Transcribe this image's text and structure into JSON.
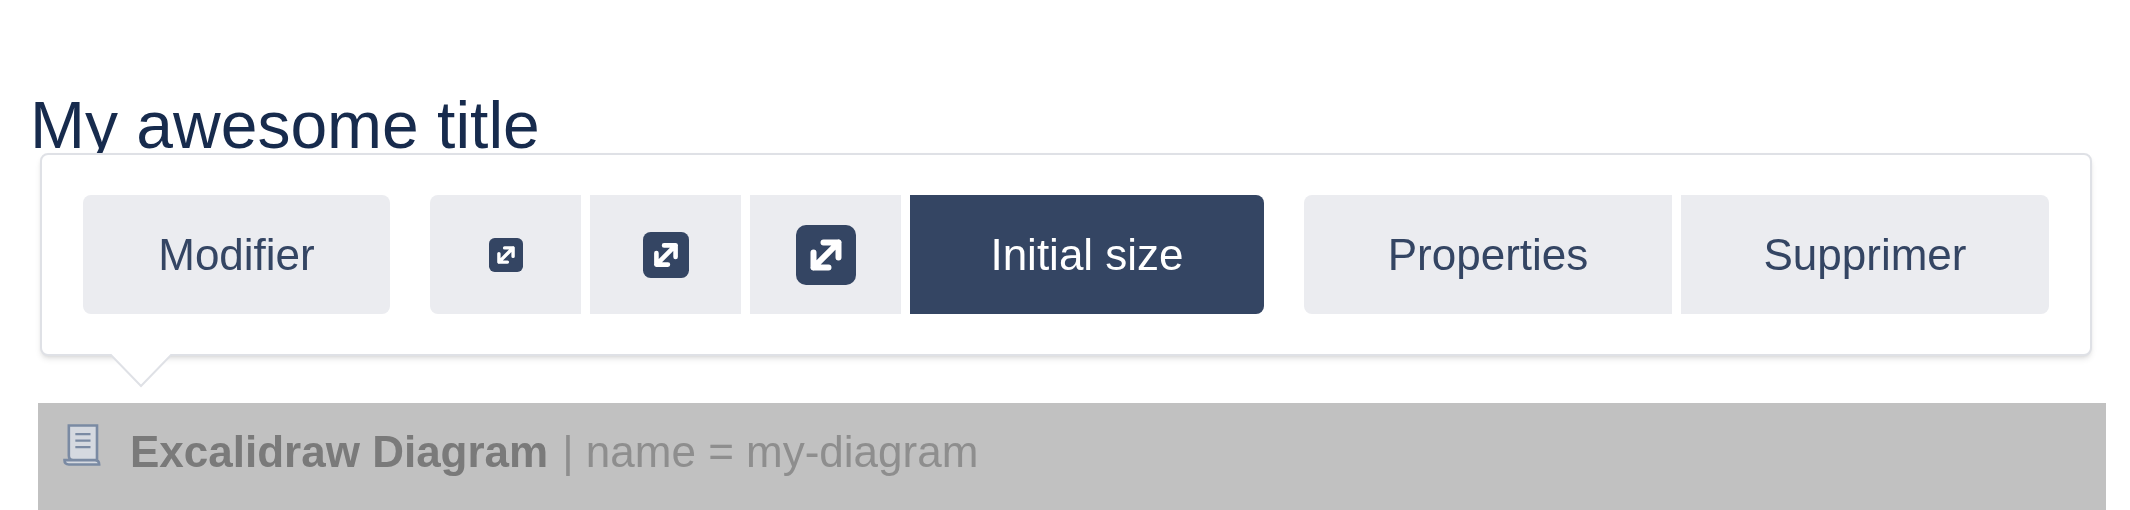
{
  "page_title": "My awesome title",
  "toolbar": {
    "edit_button": "Modifier",
    "size_buttons": [
      {
        "kind": "small-icon",
        "selected": false
      },
      {
        "kind": "medium-icon",
        "selected": false
      },
      {
        "kind": "large-icon",
        "selected": false
      },
      {
        "kind": "text",
        "label": "Initial size",
        "selected": true
      }
    ],
    "action_buttons": [
      "Properties",
      "Supprimer"
    ]
  },
  "macro": {
    "name": "Excalidraw Diagram",
    "params": "| name = my-diagram"
  }
}
